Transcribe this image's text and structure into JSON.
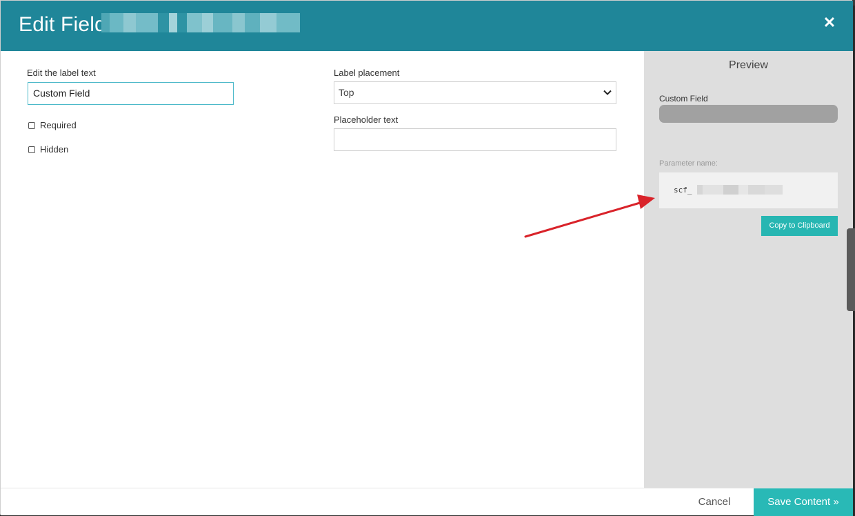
{
  "header": {
    "title": "Edit Field:",
    "close_glyph": "✕"
  },
  "form": {
    "label_text": {
      "label": "Edit the label text",
      "value": "Custom Field"
    },
    "required_label": "Required",
    "hidden_label": "Hidden",
    "label_placement": {
      "label": "Label placement",
      "selected": "Top"
    },
    "placeholder": {
      "label": "Placeholder text",
      "value": ""
    }
  },
  "preview": {
    "title": "Preview",
    "field_label": "Custom Field",
    "parameter_label": "Parameter name:",
    "parameter_value": "scf_",
    "copy_button": "Copy to Clipboard"
  },
  "footer": {
    "cancel": "Cancel",
    "save": "Save Content »"
  },
  "colors": {
    "header_bg": "#1f8699",
    "accent_teal": "#29b9b6",
    "arrow_red": "#d9232a"
  }
}
